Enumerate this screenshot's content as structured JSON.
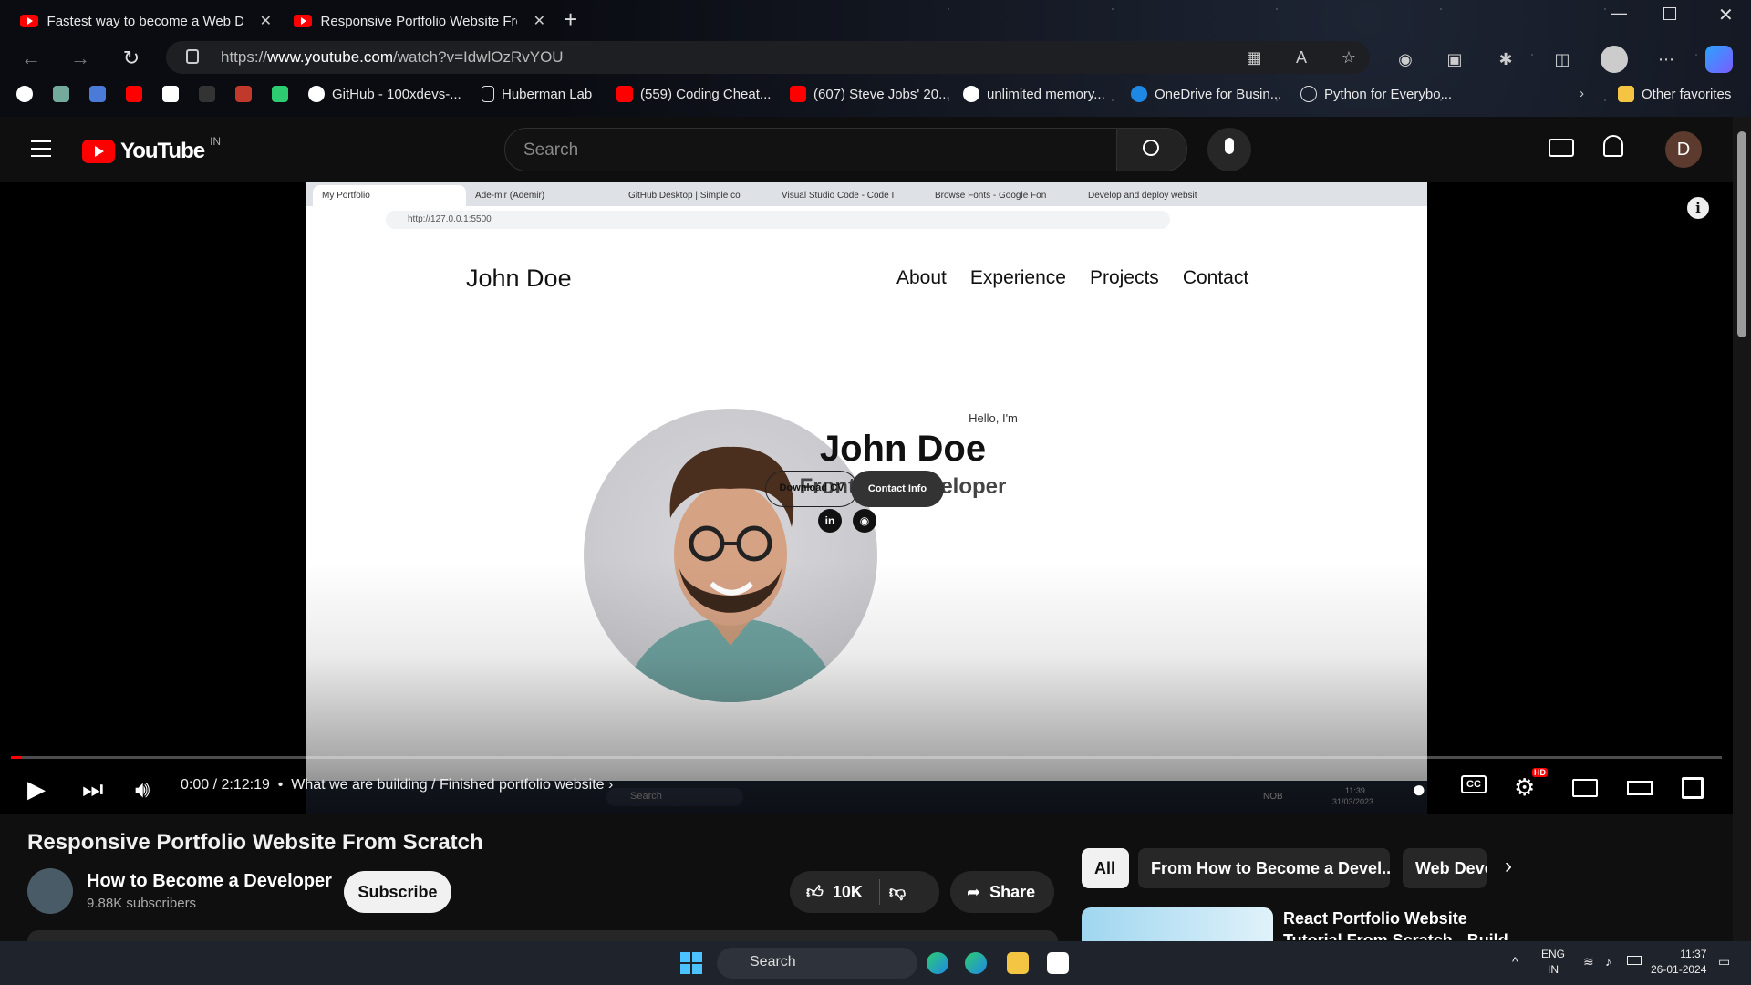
{
  "browser": {
    "tabs": [
      {
        "title": "Fastest way to become a Web De",
        "active": false
      },
      {
        "title": "Responsive Portfolio Website Fro",
        "active": true
      }
    ],
    "url_prefix": "https://",
    "url_host": "www.youtube.com",
    "url_path": "/watch?v=IdwlOzRvYOU",
    "bookmarks": [
      "GitHub - 100xdevs-...",
      "Huberman Lab",
      "(559) Coding Cheat...",
      "(607) Steve Jobs' 20...",
      "unlimited memory...",
      "OneDrive for Busin...",
      "Python for Everybo...",
      "Other favorites"
    ]
  },
  "youtube": {
    "logo_text": "YouTube",
    "country_code": "IN",
    "search_placeholder": "Search",
    "avatar_letter": "D"
  },
  "video": {
    "inner_browser": {
      "tabs": [
        "My Portfolio",
        "Ade-mir (Ademir)",
        "GitHub Desktop | Simple co",
        "Visual Studio Code - Code I",
        "Browse Fonts - Google Fon",
        "Develop and deploy websit"
      ],
      "url": "http://127.0.0.1:5500"
    },
    "site": {
      "logo": "John Doe",
      "nav": [
        "About",
        "Experience",
        "Projects",
        "Contact"
      ],
      "hello": "Hello, I'm",
      "name": "John Doe",
      "role": "Frontend Developer",
      "btn_cv": "Download CV",
      "btn_contact": "Contact Info",
      "social": [
        "in",
        "gh"
      ]
    },
    "inner_taskbar": {
      "search": "Search",
      "lang": "NOB",
      "time": "11:39",
      "date": "31/03/2023"
    },
    "progress": 0.0,
    "time_current": "0:00",
    "time_total": "2:12:19",
    "chapter": "What we are building / Finished portfolio website",
    "quality_badge": "HD"
  },
  "meta": {
    "title": "Responsive Portfolio Website From Scratch",
    "channel": "How to Become a Developer",
    "subscribers": "9.88K subscribers",
    "subscribe_label": "Subscribe",
    "likes": "10K",
    "share_label": "Share"
  },
  "chips": [
    "All",
    "From How to Become a Devel...",
    "Web Deve"
  ],
  "recommendation": {
    "title": "React Portfolio Website Tutorial From Scratch - Build & Deploy"
  },
  "taskbar": {
    "search": "Search",
    "lang1": "ENG",
    "lang2": "IN",
    "time": "11:37",
    "date": "26-01-2024"
  },
  "colors": {
    "youtube_red": "#ff0000",
    "bg": "#0f0f0f"
  }
}
